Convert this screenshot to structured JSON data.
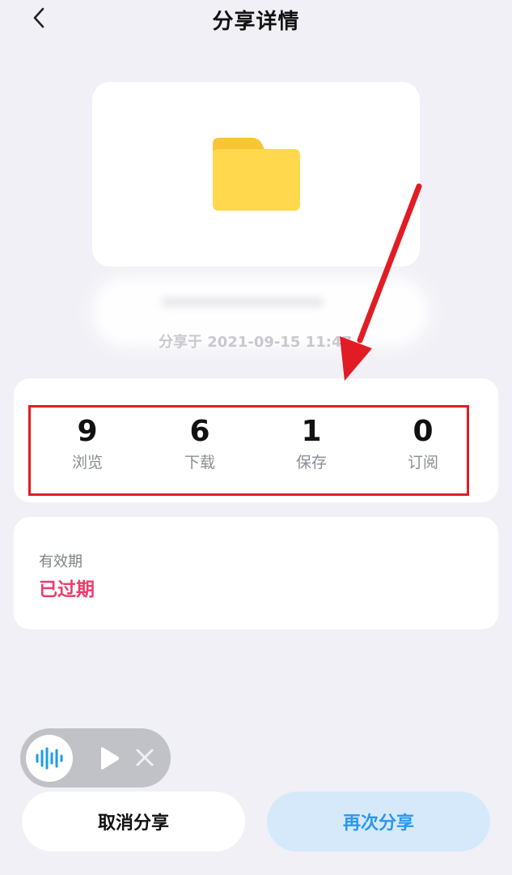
{
  "header": {
    "title": "分享详情"
  },
  "file": {
    "icon": "folder-icon",
    "share_time": "分享于 2021-09-15 11:47"
  },
  "stats": [
    {
      "value": "9",
      "label": "浏览"
    },
    {
      "value": "6",
      "label": "下载"
    },
    {
      "value": "1",
      "label": "保存"
    },
    {
      "value": "0",
      "label": "订阅"
    }
  ],
  "expiry": {
    "label": "有效期",
    "value": "已过期"
  },
  "actions": {
    "cancel_label": "取消分享",
    "reshare_label": "再次分享"
  },
  "colors": {
    "accent_blue": "#2a98ec",
    "expired_red": "#ee3c6a",
    "annotation_red": "#e11c24",
    "folder_yellow": "#ffd84d"
  }
}
